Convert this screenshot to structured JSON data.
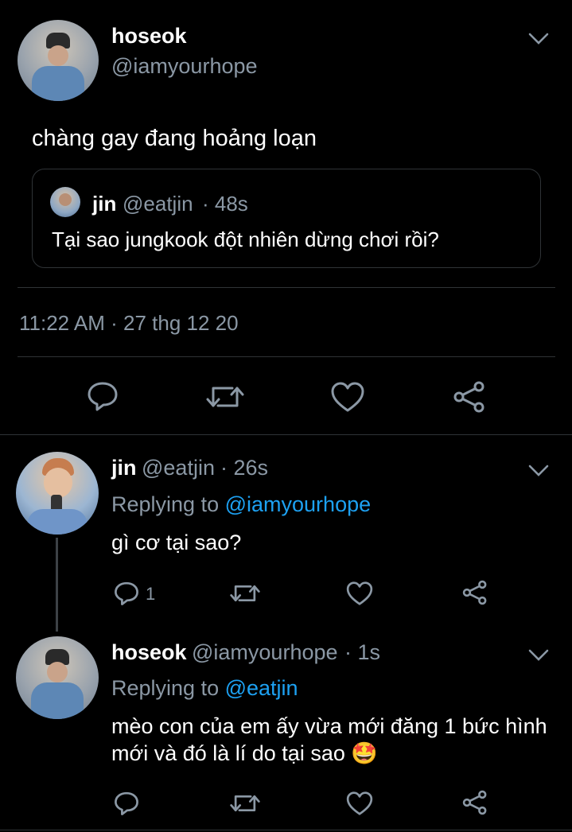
{
  "main_tweet": {
    "display_name": "hoseok",
    "handle": "@iamyourhope",
    "text": "chàng gay đang hoảng loạn",
    "timestamp": "11:22 AM · 27 thg 12 20",
    "quoted": {
      "display_name": "jin",
      "handle": "@eatjin",
      "time": "· 48s",
      "text": "Tại sao jungkook đột nhiên dừng chơi rồi?"
    }
  },
  "replies": [
    {
      "display_name": "jin",
      "handle": "@eatjin",
      "time": "· 26s",
      "replying_prefix": "Replying to",
      "replying_to": "@iamyourhope",
      "text": "gì cơ tại sao?",
      "reply_count": "1"
    },
    {
      "display_name": "hoseok",
      "handle": "@iamyourhope",
      "time": "· 1s",
      "replying_prefix": "Replying to",
      "replying_to": "@eatjin",
      "text_line1": "mèo con của em ấy vừa mới đăng 1 bức hình",
      "text_line2": "mới và đó là lí do tại sao",
      "emoji": "🤩"
    }
  ],
  "icons": [
    "chevron-down-icon",
    "reply-icon",
    "retweet-icon",
    "like-icon",
    "share-icon"
  ],
  "colors": {
    "background": "#000000",
    "secondary_text": "#8b98a5",
    "link": "#1da1f2",
    "divider": "#2f3336"
  }
}
